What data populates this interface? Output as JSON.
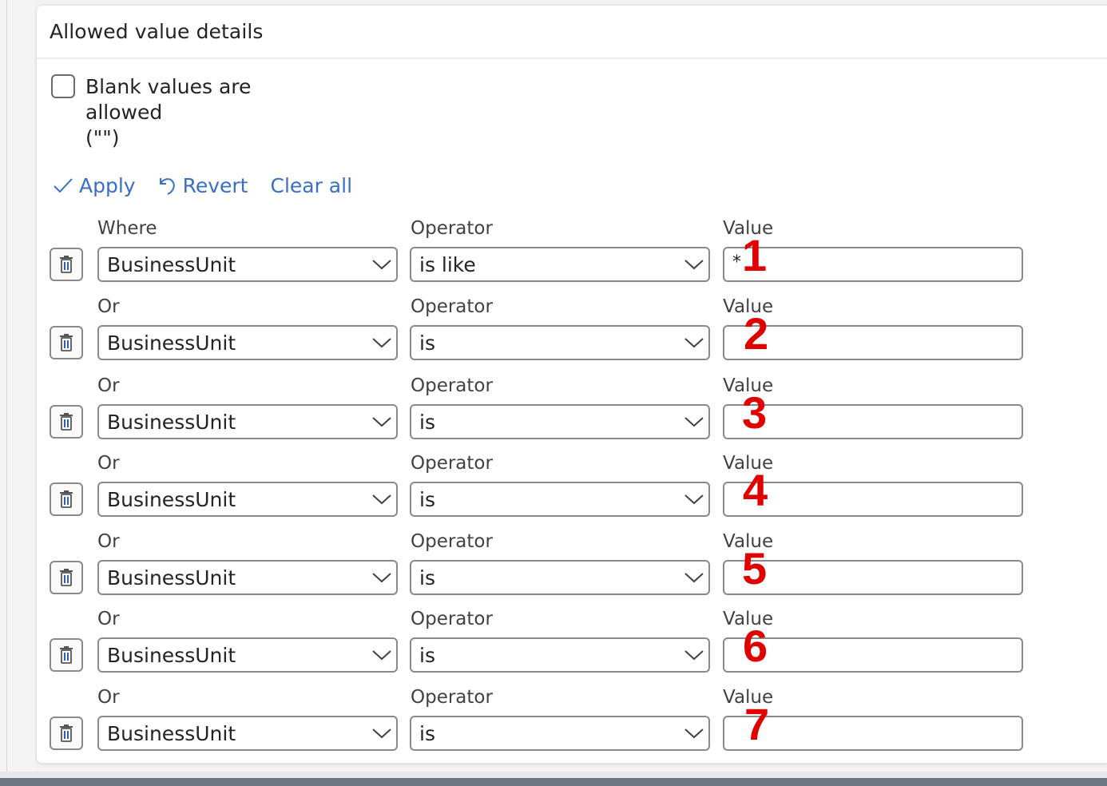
{
  "panel": {
    "title": "Allowed value details",
    "blank_checkbox": {
      "label_line1": "Blank values are allowed",
      "label_line2": "(\"\")",
      "checked": false
    },
    "actions": {
      "apply": "Apply",
      "revert": "Revert",
      "clear_all": "Clear all"
    }
  },
  "rows": [
    {
      "where_label": "Where",
      "where_value": "BusinessUnit",
      "operator_label": "Operator",
      "operator_value": "is like",
      "value_label": "Value",
      "value": "*",
      "callout": "1"
    },
    {
      "where_label": "Or",
      "where_value": "BusinessUnit",
      "operator_label": "Operator",
      "operator_value": "is",
      "value_label": "Value",
      "value": "",
      "callout": "2"
    },
    {
      "where_label": "Or",
      "where_value": "BusinessUnit",
      "operator_label": "Operator",
      "operator_value": "is",
      "value_label": "Value",
      "value": "",
      "callout": "3"
    },
    {
      "where_label": "Or",
      "where_value": "BusinessUnit",
      "operator_label": "Operator",
      "operator_value": "is",
      "value_label": "Value",
      "value": "",
      "callout": "4"
    },
    {
      "where_label": "Or",
      "where_value": "BusinessUnit",
      "operator_label": "Operator",
      "operator_value": "is",
      "value_label": "Value",
      "value": "",
      "callout": "5"
    },
    {
      "where_label": "Or",
      "where_value": "BusinessUnit",
      "operator_label": "Operator",
      "operator_value": "is",
      "value_label": "Value",
      "value": "",
      "callout": "6"
    },
    {
      "where_label": "Or",
      "where_value": "BusinessUnit",
      "operator_label": "Operator",
      "operator_value": "is",
      "value_label": "Value",
      "value": "",
      "callout": "7"
    }
  ],
  "colors": {
    "accent": "#3a6fc4",
    "callout": "#e00000",
    "text": "#242424",
    "border": "#8a8a8a"
  },
  "icons": {
    "apply": "checkmark-icon",
    "revert": "undo-icon",
    "delete": "trash-icon",
    "dropdown": "chevron-down-icon"
  }
}
